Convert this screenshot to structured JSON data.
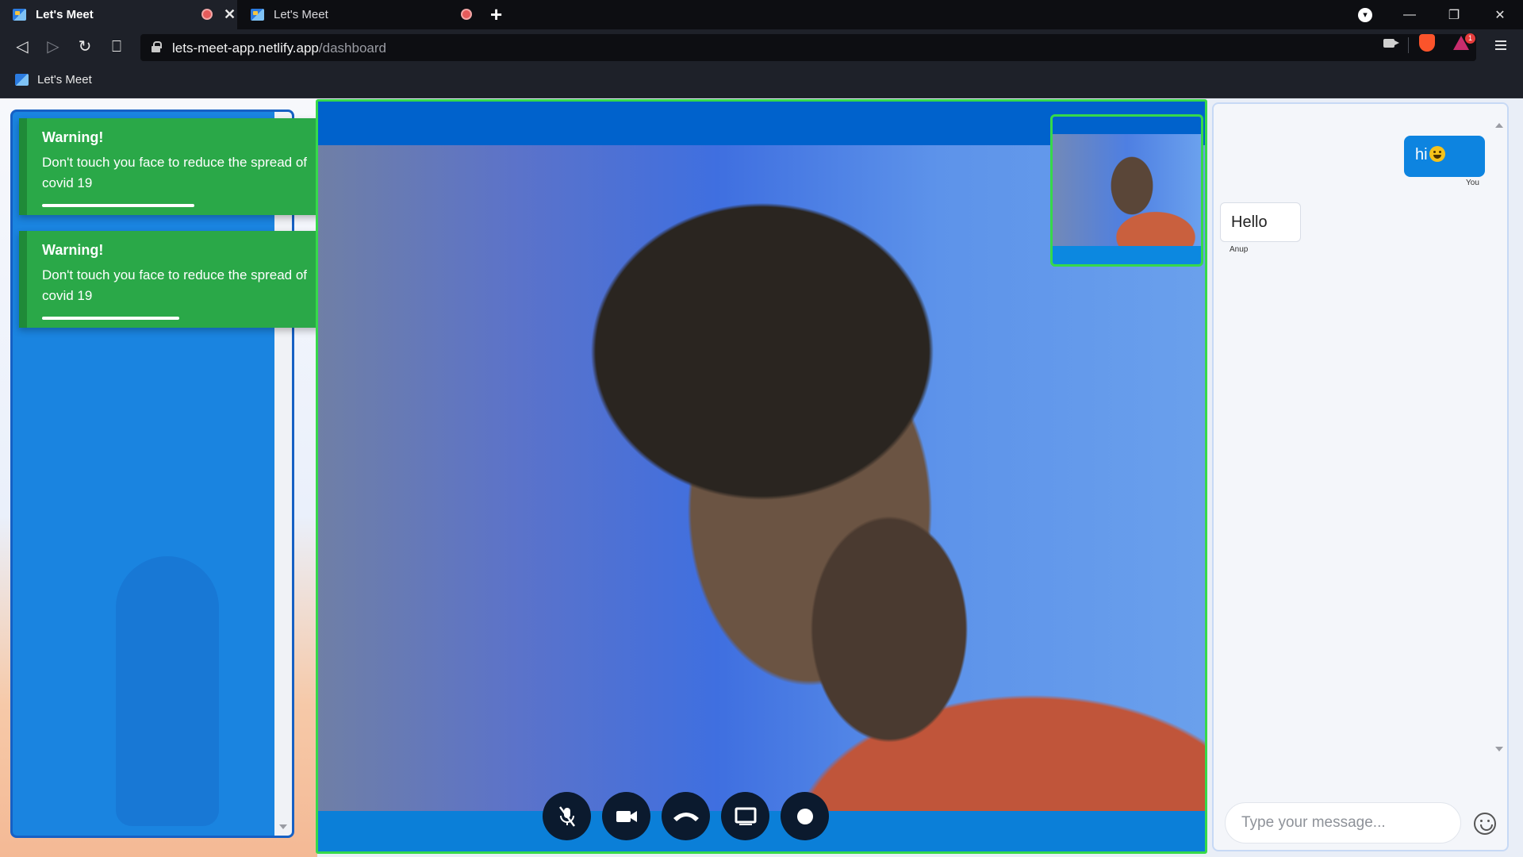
{
  "browser": {
    "tabs": [
      {
        "label": "Let's Meet",
        "active": true,
        "recording": true
      },
      {
        "label": "Let's Meet",
        "active": false,
        "recording": true
      }
    ],
    "url_host": "lets-meet-app.netlify.app",
    "url_path": "/dashboard",
    "bookmarks": [
      {
        "label": "Let's Meet"
      }
    ],
    "rewards_badge": "1",
    "icons": [
      "back-icon",
      "forward-icon",
      "reload-icon",
      "bookmark-icon",
      "lock-icon",
      "camera-icon",
      "brave-shield-icon",
      "brave-rewards-icon",
      "menu-icon"
    ]
  },
  "toasts": [
    {
      "title": "Warning!",
      "message": "Don't touch you face to reduce the spread of covid 19",
      "progress": 0.71
    },
    {
      "title": "Warning!",
      "message": "Don't touch you face to reduce the spread of covid 19",
      "progress": 0.64
    }
  ],
  "controls": [
    {
      "name": "mute-mic",
      "icon": "mic-off-icon"
    },
    {
      "name": "toggle-camera",
      "icon": "video-camera-icon"
    },
    {
      "name": "end-call",
      "icon": "phone-hangup-icon"
    },
    {
      "name": "share-screen",
      "icon": "screen-share-icon"
    },
    {
      "name": "record",
      "icon": "record-icon"
    }
  ],
  "chat": {
    "messages": [
      {
        "text": "hi",
        "sender": "You",
        "outgoing": true,
        "emoji": "grinning-face"
      },
      {
        "text": "Hello",
        "sender": "Anup",
        "outgoing": false
      }
    ],
    "input_placeholder": "Type your message..."
  },
  "colors": {
    "accent": "#0d84e0",
    "toast_green": "#2aa848",
    "video_border": "#36d94a",
    "left_panel": "#1a84e0"
  }
}
